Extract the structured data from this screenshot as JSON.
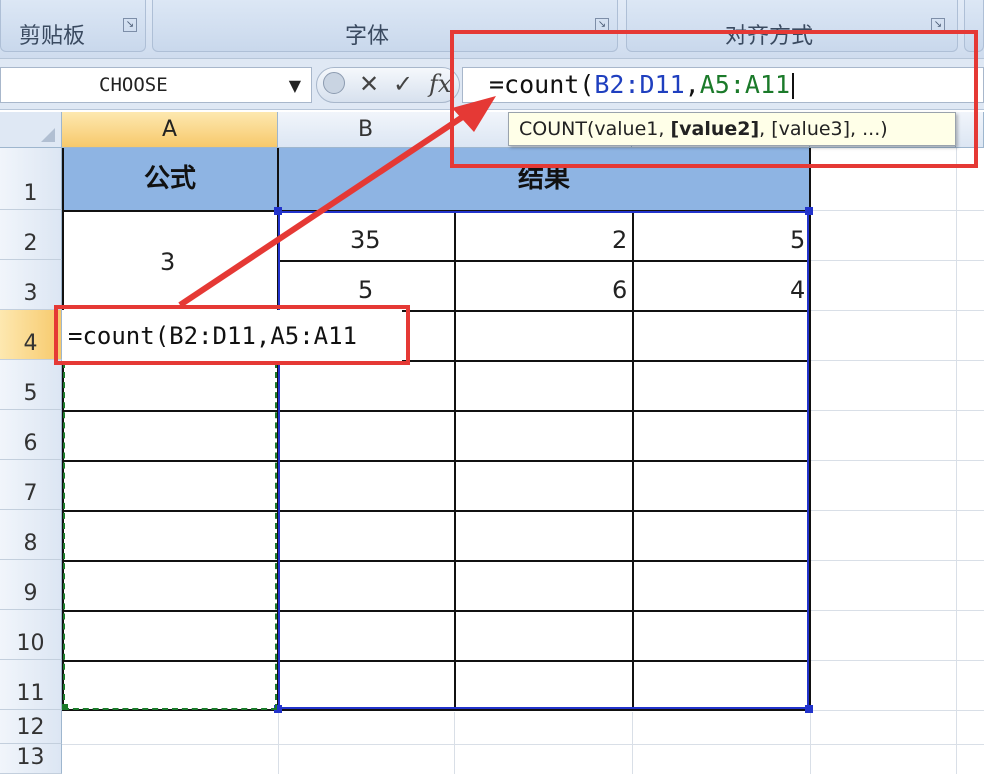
{
  "ribbon": {
    "groups": [
      {
        "label": "剪贴板"
      },
      {
        "label": "字体"
      },
      {
        "label": "对齐方式"
      }
    ]
  },
  "formula_bar": {
    "name_box": "CHOOSE",
    "cancel_symbol": "✕",
    "enter_symbol": "✓",
    "fx_symbol": "fx",
    "formula_prefix": "=count(",
    "range1": "B2:D11",
    "separator": ",",
    "range2": "A5:A11"
  },
  "tooltip": {
    "prefix": "COUNT(value1, ",
    "active_arg": "[value2]",
    "suffix": ", [value3], ...)"
  },
  "columns": [
    "A",
    "B"
  ],
  "rows": [
    "1",
    "2",
    "3",
    "4",
    "5",
    "6",
    "7",
    "8",
    "9",
    "10",
    "11",
    "12",
    "13"
  ],
  "table": {
    "header_formula": "公式",
    "header_result": "结果",
    "a2": "3",
    "b2": "35",
    "c2": "2",
    "d2": "5",
    "b3": "5",
    "c3": "6",
    "d3": "4",
    "a4_edit_prefix": "=count(",
    "a4_range1": "B2:D11",
    "a4_sep": ",",
    "a4_range2": "A5:A11"
  },
  "colors": {
    "header_fill": "#8eb4e3",
    "range1_color": "#1f3fbf",
    "range2_color": "#1b7a2a",
    "highlight_red": "#e53935",
    "selected_header": "#f7c96b"
  }
}
